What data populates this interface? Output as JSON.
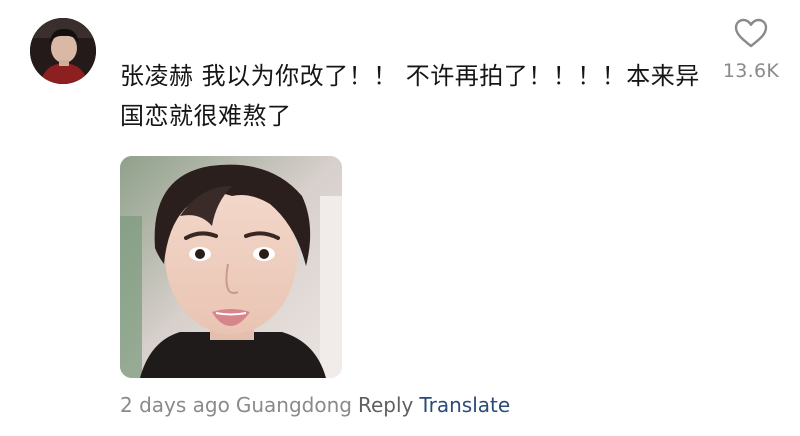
{
  "comment": {
    "text": "张凌赫 我以为你改了！！ 不许再拍了！！！！本来异国恋就很难熬了",
    "likes": "13.6K",
    "time_ago": "2 days ago",
    "location": "Guangdong",
    "reply_label": "Reply",
    "translate_label": "Translate"
  },
  "icons": {
    "like": "heart-outline-icon"
  },
  "colors": {
    "text_primary": "#161616",
    "text_secondary": "#8a8a8a",
    "reply": "#5f5f5f",
    "translate": "#2b4a77"
  }
}
